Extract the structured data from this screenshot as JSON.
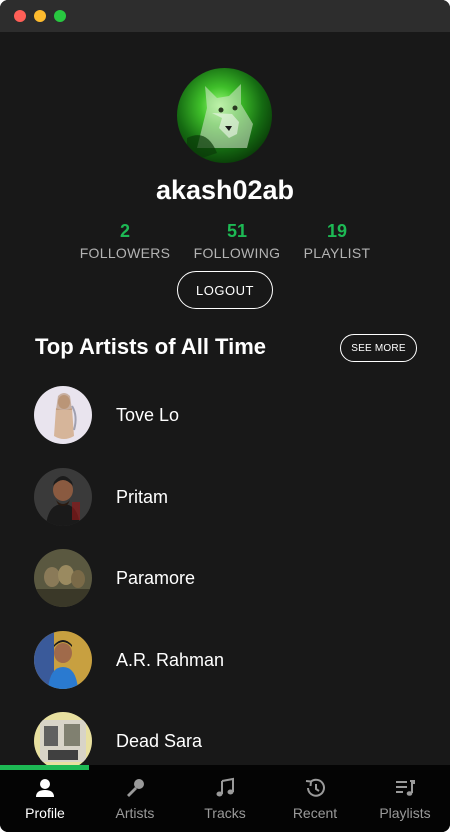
{
  "profile": {
    "username": "akash02ab",
    "stats": [
      {
        "value": "2",
        "label": "FOLLOWERS"
      },
      {
        "value": "51",
        "label": "FOLLOWING"
      },
      {
        "value": "19",
        "label": "PLAYLIST"
      }
    ],
    "logout_label": "LOGOUT"
  },
  "top_artists": {
    "title": "Top Artists of All Time",
    "see_more_label": "SEE MORE",
    "items": [
      {
        "name": "Tove Lo"
      },
      {
        "name": "Pritam"
      },
      {
        "name": "Paramore"
      },
      {
        "name": "A.R. Rahman"
      },
      {
        "name": "Dead Sara"
      }
    ]
  },
  "nav": {
    "items": [
      {
        "label": "Profile",
        "icon": "user-icon"
      },
      {
        "label": "Artists",
        "icon": "microphone-icon"
      },
      {
        "label": "Tracks",
        "icon": "music-note-icon"
      },
      {
        "label": "Recent",
        "icon": "history-icon"
      },
      {
        "label": "Playlists",
        "icon": "playlist-icon"
      }
    ]
  },
  "colors": {
    "accent": "#1db954",
    "background": "#181818",
    "nav_background": "#040404"
  }
}
